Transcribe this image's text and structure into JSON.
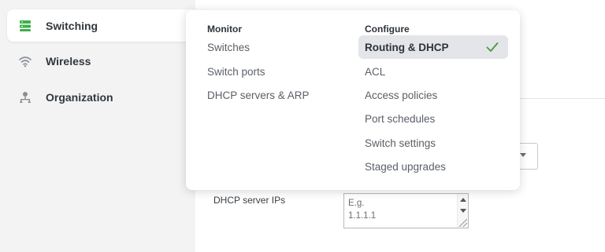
{
  "sidebar": {
    "items": [
      {
        "label": "Switching",
        "icon": "switch-icon",
        "active": true
      },
      {
        "label": "Wireless",
        "icon": "wifi-icon",
        "active": false
      },
      {
        "label": "Organization",
        "icon": "organization-icon",
        "active": false
      }
    ]
  },
  "menu": {
    "monitor": {
      "heading": "Monitor",
      "items": [
        "Switches",
        "Switch ports",
        "DHCP servers & ARP"
      ]
    },
    "configure": {
      "heading": "Configure",
      "items": [
        "Routing & DHCP",
        "ACL",
        "Access policies",
        "Port schedules",
        "Switch settings",
        "Staged upgrades"
      ],
      "selected": "Routing & DHCP",
      "selected_icon": "checkmark-icon"
    }
  },
  "form": {
    "dhcp_label": "DHCP server IPs",
    "dhcp_placeholder": "E.g.\n1.1.1.1"
  },
  "colors": {
    "switch_icon": "#3fae49",
    "check": "#4a9a3b",
    "sidebar_bg": "#f3f3f4"
  }
}
